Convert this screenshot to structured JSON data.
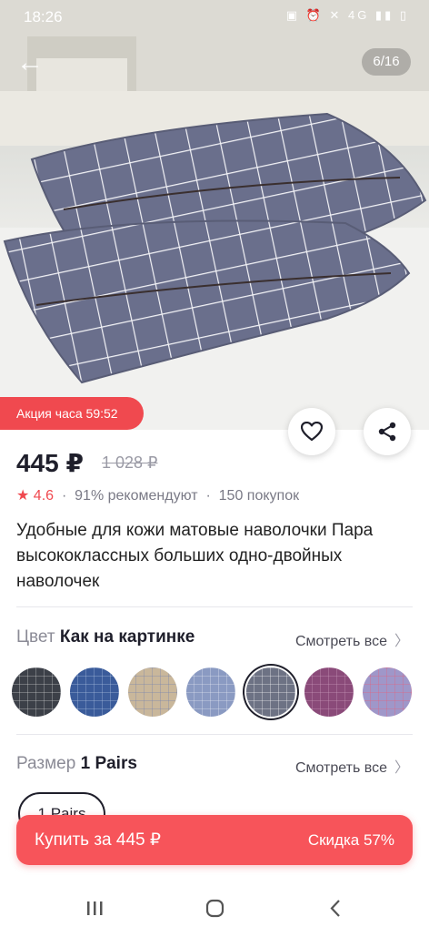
{
  "status_bar": {
    "time": "18:26",
    "icons_right": "4G"
  },
  "gallery": {
    "counter": "6/16",
    "back_icon": "arrow-left-icon"
  },
  "promo": {
    "label": "Акция часа 59:52"
  },
  "product": {
    "price": "445 ₽",
    "old_price": "1 028 ₽",
    "rating": "4.6",
    "recommend": "91% рекомендуют",
    "purchases": "150 покупок",
    "separator": "·",
    "title": "Удобные для кожи матовые наволочки Пара высококлассных больших одно-двойных наволочек"
  },
  "color_section": {
    "label": "Цвет",
    "value": "Как на картинке",
    "see_all": "Смотреть все"
  },
  "color_swatches": [
    {
      "name": "dark-grey-leaf",
      "color": "#3c4048",
      "accent": "#d9d9d9"
    },
    {
      "name": "blue-white",
      "color": "#3a5b9a",
      "accent": "#b9c9e6"
    },
    {
      "name": "beige-cartoon",
      "color": "#c9b79b",
      "accent": "#6e7fb0"
    },
    {
      "name": "blue-check",
      "color": "#8a9ac2",
      "accent": "#e8ebf4"
    },
    {
      "name": "grey-check-selected",
      "color": "#6d7284",
      "accent": "#ffffff"
    },
    {
      "name": "purple",
      "color": "#8a4a79",
      "accent": "#cfa0c0"
    },
    {
      "name": "lavender-check",
      "color": "#9f97c9",
      "accent": "#e85d78"
    }
  ],
  "size_section": {
    "label": "Размер",
    "value": "1 Pairs",
    "see_all": "Смотреть все",
    "chip": "1 Pairs"
  },
  "buy_bar": {
    "buy_label": "Купить за 445 ₽",
    "discount_label": "Скидка 57%"
  },
  "colors": {
    "accent": "#f0494f",
    "text": "#1f1f2b",
    "muted": "#8b8b96"
  }
}
